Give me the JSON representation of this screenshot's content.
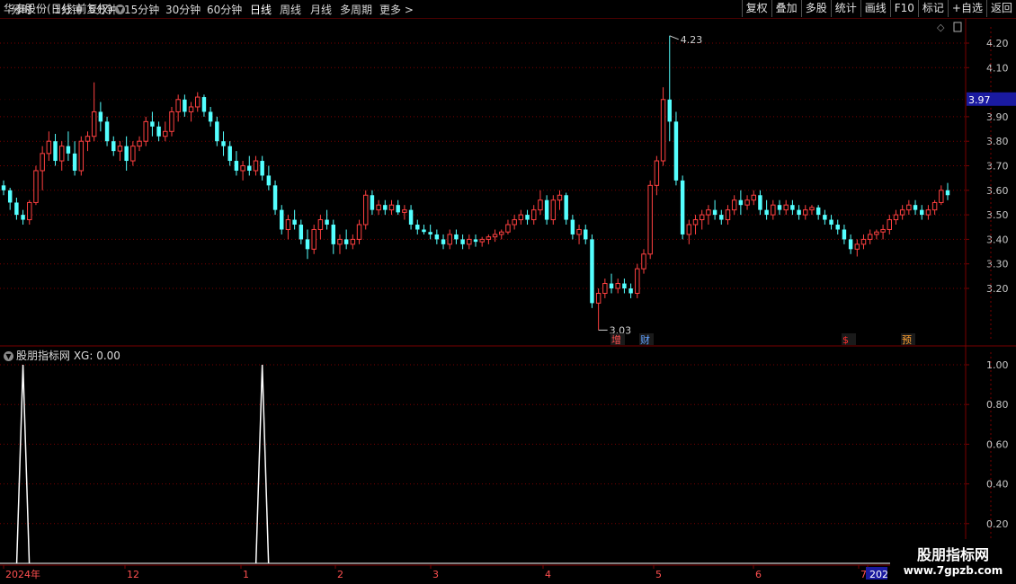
{
  "toolbar": {
    "periods": [
      "分时",
      "1分钟",
      "5分钟",
      "15分钟",
      "30分钟",
      "60分钟",
      "日线",
      "周线",
      "月线",
      "多周期",
      "更多 >"
    ],
    "active_index": 6,
    "right_buttons": [
      "复权",
      "叠加",
      "多股",
      "统计",
      "画线",
      "F10",
      "标记",
      "+自选",
      "返回"
    ]
  },
  "main": {
    "title": "华泰股份(日线 前复权)",
    "high_label": "4.23",
    "low_label": "3.03",
    "current_price": "3.97",
    "markers": [
      {
        "text": "增",
        "color": "#ff5050"
      },
      {
        "text": "财",
        "color": "#60a0ff"
      },
      {
        "text": "$",
        "color": "#ff3030"
      },
      {
        "text": "预",
        "color": "#ffa030"
      }
    ]
  },
  "indicator": {
    "title": "股朋指标网 XG: 0.00"
  },
  "axis": {
    "price_ticks": [
      "4.20",
      "4.10",
      "3.90",
      "3.80",
      "3.70",
      "3.60",
      "3.50",
      "3.40",
      "3.30",
      "3.20"
    ],
    "ind_ticks": [
      "1.00",
      "0.80",
      "0.60",
      "0.40",
      "0.20"
    ],
    "date_labels": [
      "2024年",
      "12",
      "1",
      "2",
      "3",
      "4",
      "5",
      "6",
      "7",
      "202"
    ]
  },
  "watermark": {
    "line1": "股朋指标网",
    "line2": "www.7gpzb.com"
  },
  "colors": {
    "up": "#ff4040",
    "down": "#54ffff",
    "grid": "#7a0000",
    "highlight": "#1a1aa0"
  },
  "candles": [
    [
      3.62,
      3.64,
      3.58,
      3.6
    ],
    [
      3.6,
      3.61,
      3.52,
      3.55
    ],
    [
      3.55,
      3.57,
      3.48,
      3.5
    ],
    [
      3.5,
      3.52,
      3.46,
      3.48
    ],
    [
      3.48,
      3.56,
      3.46,
      3.55
    ],
    [
      3.55,
      3.7,
      3.54,
      3.68
    ],
    [
      3.68,
      3.78,
      3.6,
      3.75
    ],
    [
      3.75,
      3.84,
      3.72,
      3.8
    ],
    [
      3.8,
      3.83,
      3.7,
      3.72
    ],
    [
      3.72,
      3.8,
      3.68,
      3.78
    ],
    [
      3.78,
      3.84,
      3.72,
      3.75
    ],
    [
      3.75,
      3.8,
      3.66,
      3.68
    ],
    [
      3.68,
      3.82,
      3.66,
      3.8
    ],
    [
      3.8,
      3.84,
      3.76,
      3.82
    ],
    [
      3.82,
      4.04,
      3.8,
      3.92
    ],
    [
      3.92,
      3.96,
      3.84,
      3.88
    ],
    [
      3.88,
      3.9,
      3.78,
      3.8
    ],
    [
      3.8,
      3.82,
      3.74,
      3.76
    ],
    [
      3.76,
      3.8,
      3.72,
      3.78
    ],
    [
      3.78,
      3.82,
      3.68,
      3.72
    ],
    [
      3.72,
      3.8,
      3.7,
      3.78
    ],
    [
      3.78,
      3.82,
      3.76,
      3.8
    ],
    [
      3.8,
      3.9,
      3.78,
      3.88
    ],
    [
      3.88,
      3.92,
      3.82,
      3.86
    ],
    [
      3.86,
      3.88,
      3.8,
      3.82
    ],
    [
      3.82,
      3.88,
      3.8,
      3.84
    ],
    [
      3.84,
      3.94,
      3.82,
      3.92
    ],
    [
      3.92,
      3.99,
      3.88,
      3.97
    ],
    [
      3.97,
      3.99,
      3.9,
      3.92
    ],
    [
      3.92,
      3.96,
      3.88,
      3.94
    ],
    [
      3.94,
      4.0,
      3.92,
      3.98
    ],
    [
      3.98,
      3.99,
      3.9,
      3.92
    ],
    [
      3.92,
      3.94,
      3.86,
      3.88
    ],
    [
      3.88,
      3.9,
      3.78,
      3.8
    ],
    [
      3.8,
      3.84,
      3.74,
      3.78
    ],
    [
      3.78,
      3.8,
      3.7,
      3.72
    ],
    [
      3.72,
      3.76,
      3.66,
      3.68
    ],
    [
      3.68,
      3.72,
      3.64,
      3.7
    ],
    [
      3.7,
      3.74,
      3.66,
      3.68
    ],
    [
      3.68,
      3.74,
      3.66,
      3.72
    ],
    [
      3.72,
      3.74,
      3.64,
      3.66
    ],
    [
      3.66,
      3.7,
      3.6,
      3.62
    ],
    [
      3.62,
      3.64,
      3.5,
      3.52
    ],
    [
      3.52,
      3.54,
      3.42,
      3.44
    ],
    [
      3.44,
      3.5,
      3.4,
      3.48
    ],
    [
      3.48,
      3.52,
      3.44,
      3.46
    ],
    [
      3.46,
      3.48,
      3.38,
      3.4
    ],
    [
      3.4,
      3.44,
      3.32,
      3.36
    ],
    [
      3.36,
      3.46,
      3.34,
      3.44
    ],
    [
      3.44,
      3.5,
      3.4,
      3.48
    ],
    [
      3.48,
      3.52,
      3.44,
      3.46
    ],
    [
      3.46,
      3.48,
      3.34,
      3.38
    ],
    [
      3.38,
      3.42,
      3.34,
      3.4
    ],
    [
      3.4,
      3.44,
      3.36,
      3.38
    ],
    [
      3.38,
      3.42,
      3.36,
      3.4
    ],
    [
      3.4,
      3.48,
      3.38,
      3.46
    ],
    [
      3.46,
      3.6,
      3.44,
      3.58
    ],
    [
      3.58,
      3.6,
      3.5,
      3.52
    ],
    [
      3.52,
      3.56,
      3.5,
      3.54
    ],
    [
      3.54,
      3.56,
      3.5,
      3.52
    ],
    [
      3.52,
      3.56,
      3.5,
      3.54
    ],
    [
      3.54,
      3.56,
      3.5,
      3.51
    ],
    [
      3.51,
      3.54,
      3.48,
      3.52
    ],
    [
      3.52,
      3.54,
      3.44,
      3.46
    ],
    [
      3.46,
      3.48,
      3.42,
      3.44
    ],
    [
      3.44,
      3.46,
      3.42,
      3.43
    ],
    [
      3.43,
      3.46,
      3.4,
      3.42
    ],
    [
      3.42,
      3.44,
      3.38,
      3.4
    ],
    [
      3.4,
      3.42,
      3.36,
      3.38
    ],
    [
      3.38,
      3.44,
      3.36,
      3.42
    ],
    [
      3.42,
      3.44,
      3.38,
      3.4
    ],
    [
      3.4,
      3.42,
      3.36,
      3.38
    ],
    [
      3.38,
      3.42,
      3.36,
      3.4
    ],
    [
      3.4,
      3.42,
      3.37,
      3.39
    ],
    [
      3.39,
      3.41,
      3.37,
      3.4
    ],
    [
      3.4,
      3.42,
      3.38,
      3.41
    ],
    [
      3.41,
      3.44,
      3.39,
      3.42
    ],
    [
      3.42,
      3.44,
      3.4,
      3.43
    ],
    [
      3.43,
      3.48,
      3.42,
      3.46
    ],
    [
      3.46,
      3.5,
      3.44,
      3.48
    ],
    [
      3.48,
      3.52,
      3.46,
      3.5
    ],
    [
      3.5,
      3.52,
      3.46,
      3.48
    ],
    [
      3.48,
      3.54,
      3.46,
      3.52
    ],
    [
      3.52,
      3.6,
      3.5,
      3.56
    ],
    [
      3.56,
      3.58,
      3.46,
      3.48
    ],
    [
      3.48,
      3.58,
      3.46,
      3.56
    ],
    [
      3.56,
      3.6,
      3.52,
      3.58
    ],
    [
      3.58,
      3.59,
      3.46,
      3.48
    ],
    [
      3.48,
      3.5,
      3.4,
      3.42
    ],
    [
      3.42,
      3.46,
      3.38,
      3.44
    ],
    [
      3.44,
      3.46,
      3.38,
      3.4
    ],
    [
      3.4,
      3.42,
      3.12,
      3.14
    ],
    [
      3.14,
      3.2,
      3.03,
      3.18
    ],
    [
      3.18,
      3.24,
      3.16,
      3.22
    ],
    [
      3.22,
      3.26,
      3.18,
      3.2
    ],
    [
      3.2,
      3.24,
      3.18,
      3.22
    ],
    [
      3.22,
      3.24,
      3.18,
      3.2
    ],
    [
      3.2,
      3.22,
      3.16,
      3.18
    ],
    [
      3.18,
      3.3,
      3.16,
      3.28
    ],
    [
      3.28,
      3.36,
      3.26,
      3.34
    ],
    [
      3.34,
      3.64,
      3.32,
      3.62
    ],
    [
      3.62,
      3.74,
      3.58,
      3.72
    ],
    [
      3.72,
      4.02,
      3.7,
      3.97
    ],
    [
      3.97,
      4.23,
      3.8,
      3.88
    ],
    [
      3.88,
      3.92,
      3.62,
      3.64
    ],
    [
      3.64,
      3.66,
      3.4,
      3.42
    ],
    [
      3.42,
      3.48,
      3.38,
      3.46
    ],
    [
      3.46,
      3.5,
      3.42,
      3.48
    ],
    [
      3.48,
      3.52,
      3.44,
      3.5
    ],
    [
      3.5,
      3.54,
      3.46,
      3.52
    ],
    [
      3.52,
      3.56,
      3.48,
      3.5
    ],
    [
      3.5,
      3.52,
      3.46,
      3.48
    ],
    [
      3.48,
      3.54,
      3.46,
      3.52
    ],
    [
      3.52,
      3.58,
      3.5,
      3.56
    ],
    [
      3.56,
      3.6,
      3.5,
      3.54
    ],
    [
      3.54,
      3.58,
      3.52,
      3.56
    ],
    [
      3.56,
      3.6,
      3.54,
      3.58
    ],
    [
      3.58,
      3.6,
      3.5,
      3.52
    ],
    [
      3.52,
      3.56,
      3.48,
      3.5
    ],
    [
      3.5,
      3.56,
      3.48,
      3.54
    ],
    [
      3.54,
      3.56,
      3.5,
      3.52
    ],
    [
      3.52,
      3.56,
      3.5,
      3.54
    ],
    [
      3.54,
      3.56,
      3.5,
      3.52
    ],
    [
      3.52,
      3.54,
      3.48,
      3.5
    ],
    [
      3.5,
      3.54,
      3.48,
      3.52
    ],
    [
      3.52,
      3.54,
      3.5,
      3.53
    ],
    [
      3.53,
      3.54,
      3.48,
      3.5
    ],
    [
      3.5,
      3.52,
      3.46,
      3.48
    ],
    [
      3.48,
      3.5,
      3.44,
      3.46
    ],
    [
      3.46,
      3.48,
      3.42,
      3.44
    ],
    [
      3.44,
      3.46,
      3.38,
      3.4
    ],
    [
      3.4,
      3.42,
      3.34,
      3.36
    ],
    [
      3.36,
      3.4,
      3.33,
      3.38
    ],
    [
      3.38,
      3.42,
      3.36,
      3.4
    ],
    [
      3.4,
      3.44,
      3.38,
      3.42
    ],
    [
      3.42,
      3.44,
      3.4,
      3.43
    ],
    [
      3.43,
      3.46,
      3.4,
      3.44
    ],
    [
      3.44,
      3.5,
      3.42,
      3.48
    ],
    [
      3.48,
      3.52,
      3.46,
      3.5
    ],
    [
      3.5,
      3.54,
      3.48,
      3.52
    ],
    [
      3.52,
      3.56,
      3.5,
      3.54
    ],
    [
      3.54,
      3.56,
      3.5,
      3.52
    ],
    [
      3.52,
      3.54,
      3.48,
      3.5
    ],
    [
      3.5,
      3.54,
      3.48,
      3.52
    ],
    [
      3.52,
      3.56,
      3.5,
      3.55
    ],
    [
      3.55,
      3.62,
      3.54,
      3.6
    ],
    [
      3.6,
      3.63,
      3.56,
      3.58
    ]
  ],
  "signal_bar_indices": [
    3,
    40
  ]
}
